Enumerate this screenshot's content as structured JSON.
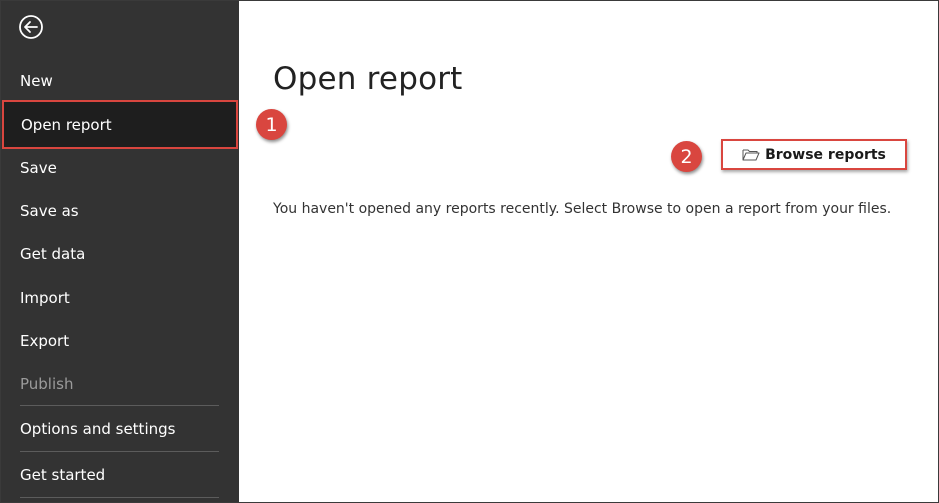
{
  "sidebar": {
    "back_icon": "back-arrow-circle-icon",
    "items": [
      {
        "label": "New"
      },
      {
        "label": "Open report"
      },
      {
        "label": "Save"
      },
      {
        "label": "Save as"
      },
      {
        "label": "Get data"
      },
      {
        "label": "Import"
      },
      {
        "label": "Export"
      },
      {
        "label": "Publish"
      },
      {
        "label": "Options and settings"
      },
      {
        "label": "Get started"
      }
    ]
  },
  "main": {
    "title": "Open report",
    "browse_button": {
      "label": "Browse reports",
      "icon": "folder-open-icon"
    },
    "empty_message": "You haven't opened any reports recently. Select Browse to open a report from your files."
  },
  "annotations": {
    "step1": "1",
    "step2": "2"
  },
  "colors": {
    "sidebar_bg": "#333333",
    "selected_bg": "#1e1e1e",
    "annotation_red": "#d9463f"
  }
}
